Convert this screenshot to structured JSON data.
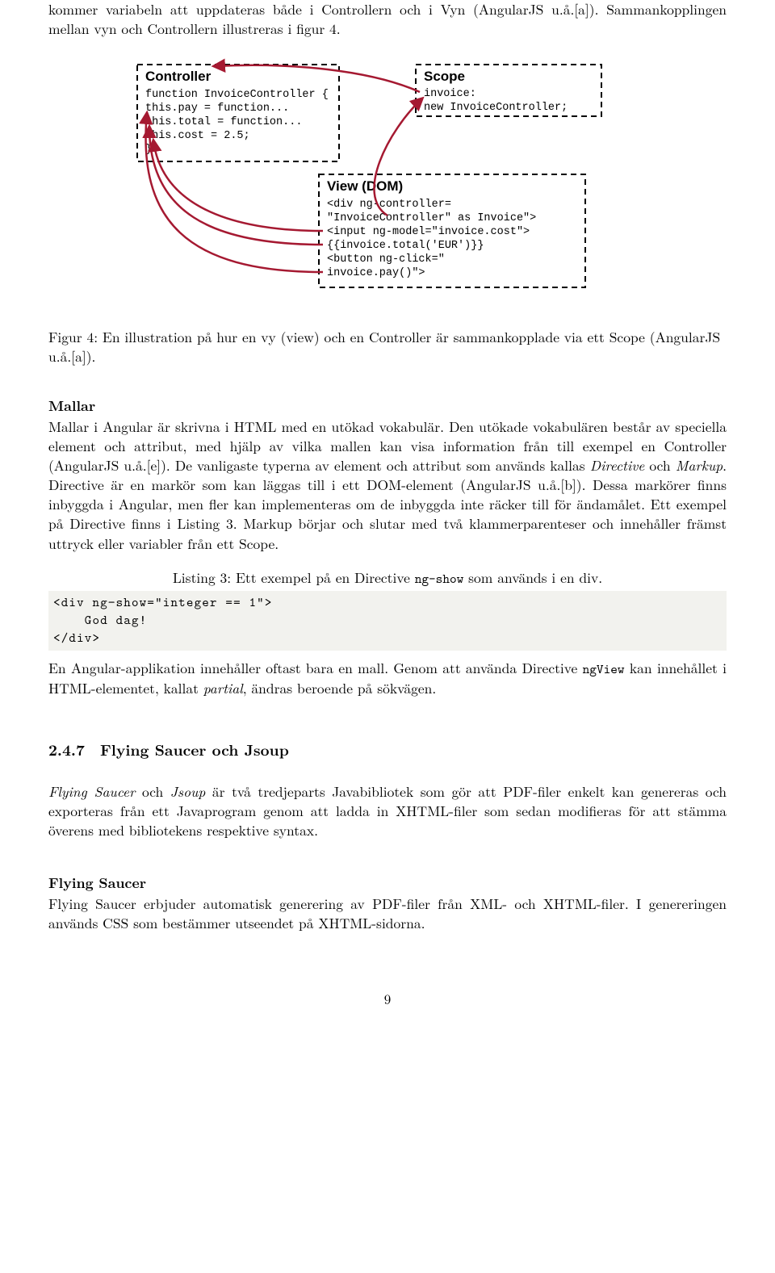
{
  "top_para": "kommer variabeln att uppdateras både i Controllern och i Vyn (AngularJS u.å.[a]). Sammankopplingen mellan vyn och Controllern illustreras i figur 4.",
  "figure": {
    "controller": {
      "title": "Controller",
      "l1": "function InvoiceController {",
      "l2": "this.pay  = function...",
      "l3": "this.total = function...",
      "l4": "this.cost  = 2.5;",
      "l5": "}"
    },
    "scope": {
      "title": "Scope",
      "l1": "invoice:",
      "l2": "new InvoiceController;"
    },
    "view": {
      "title": "View (DOM)",
      "l1": "<div ng-controller=",
      "l2": "  \"InvoiceController\" as Invoice\">",
      "l3": "<input ng-model=\"invoice.cost\">",
      "l4": "{{invoice.total('EUR')}}",
      "l5": "<button ng-click=\"",
      "l6": "  invoice.pay()\">"
    }
  },
  "figure_caption": "Figur 4: En illustration på hur en vy (view) och en Controller är sammankopplade via ett Scope (AngularJS u.å.[a]).",
  "mallar_heading": "Mallar",
  "mallar_para_parts": {
    "p1": "Mallar i Angular är skrivna i HTML med en utökad vokabulär. Den utökade vokabulären består av speciella element och attribut, med hjälp av vilka mallen kan visa information från till exempel en Controller (AngularJS u.å.[e]). De vanligaste typerna av element och attribut som används kallas ",
    "i1": "Directive",
    "p2": " och ",
    "i2": "Markup",
    "p3": ". Directive är en markör som kan läggas till i ett DOM-element (AngularJS u.å.[b]). Dessa markörer finns inbyggda i Angular, men fler kan implementeras om de inbyggda inte räcker till för ändamålet. Ett exempel på Directive finns i Listing 3. Markup börjar och slutar med två klammerparenteser och innehåller främst uttryck eller variabler från ett Scope."
  },
  "listing_caption_prefix": "Listing 3: Ett exempel på en Directive ",
  "listing_caption_code": "ng-show",
  "listing_caption_suffix": " som används i en div.",
  "listing_code": "<div ng−show=\"integer == 1\">\n    God dag!\n</div>",
  "after_listing_parts": {
    "p1": "En Angular-applikation innehåller oftast bara en mall. Genom att använda Directive ",
    "code": "ngView",
    "p2": " kan innehållet i HTML-elementet, kallat ",
    "i1": "partial",
    "p3": ", ändras beroende på sökvägen."
  },
  "section_number": "2.4.7",
  "section_title": "Flying Saucer och Jsoup",
  "fs_jsoup_para_parts": {
    "i1": "Flying Saucer",
    "p1": " och ",
    "i2": "Jsoup",
    "p2": " är två tredjeparts Javabibliotek som gör att PDF-filer enkelt kan genereras och exporteras från ett Javaprogram genom att ladda in XHTML-filer som sedan modifieras för att stämma överens med bibliotekens respektive syntax."
  },
  "fs_heading": "Flying Saucer",
  "fs_para": "Flying Saucer erbjuder automatisk generering av PDF-filer från XML- och XHTML-filer. I genereringen används CSS som bestämmer utseendet på XHTML-sidorna.",
  "page_number": "9"
}
